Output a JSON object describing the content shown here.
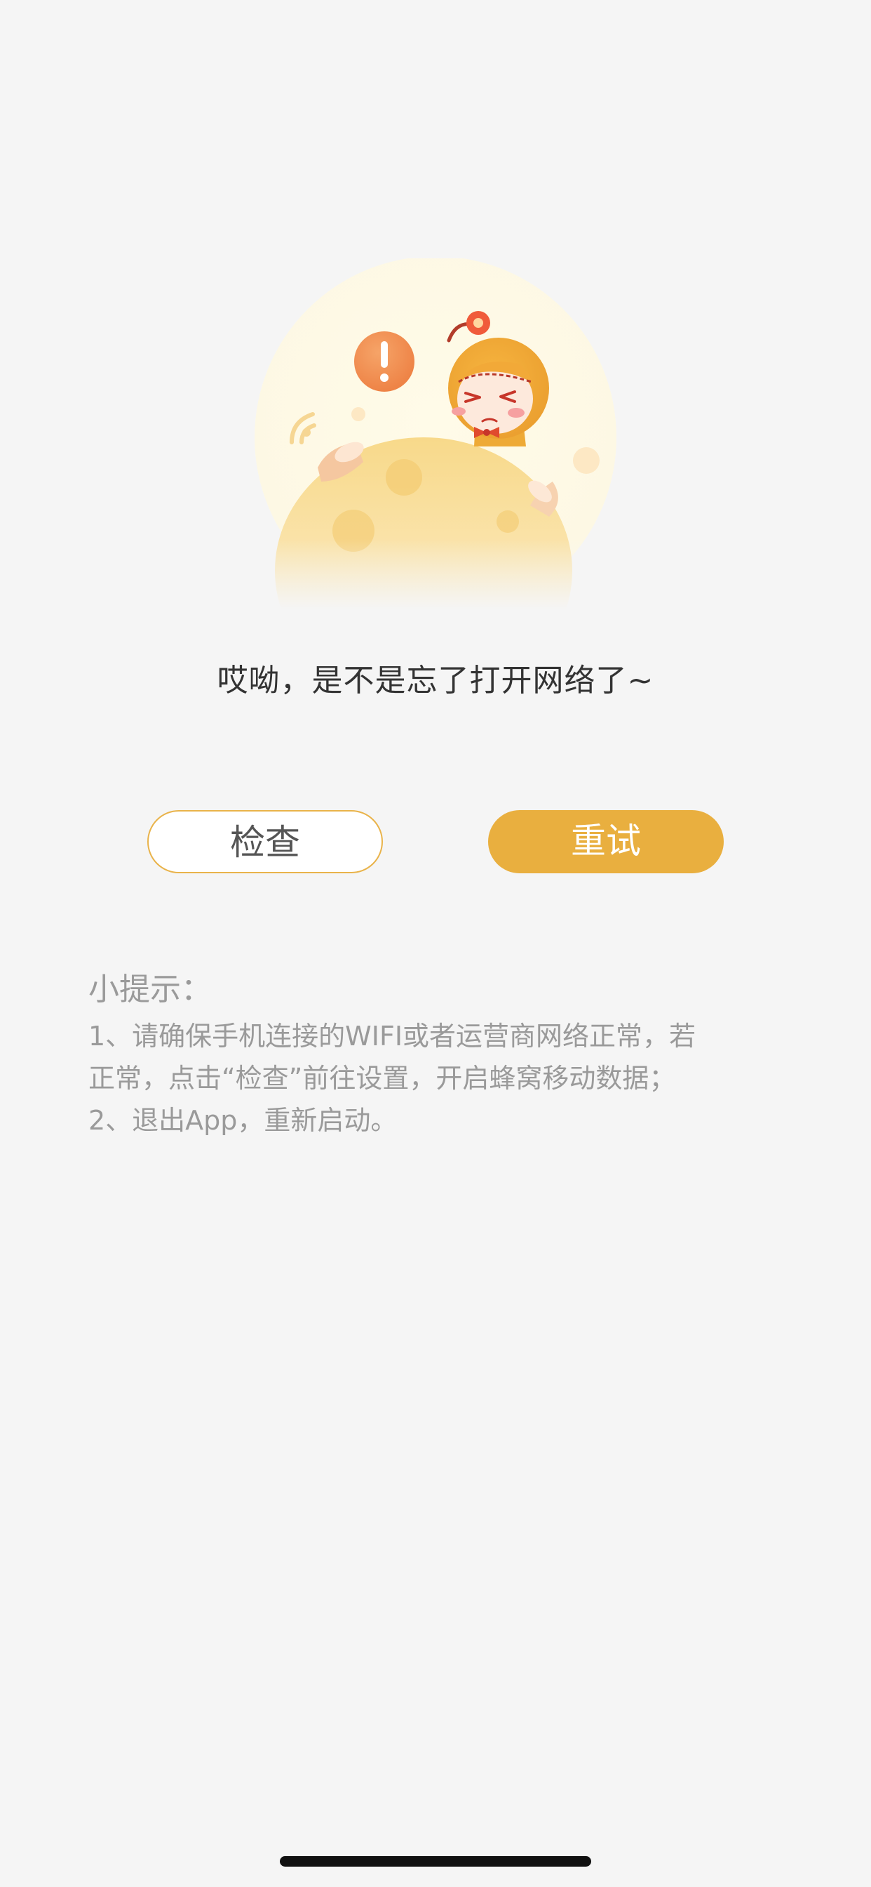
{
  "error": {
    "message": "哎呦，是不是忘了打开网络了~"
  },
  "actions": {
    "check_label": "检查",
    "retry_label": "重试"
  },
  "tips": {
    "title": "小提示：",
    "lines": [
      "1、请确保手机连接的WIFI或者运营商网络正常，若",
      "正常，点击“检查”前往设置，开启蜂窝移动数据；",
      "2、退出App，重新启动。"
    ]
  },
  "colors": {
    "accent": "#e9af3f",
    "background": "#f5f5f5",
    "tips_text": "#9a9a9a"
  },
  "icons": {
    "illustration": "no-network-moon-girl-illustration",
    "alert": "exclamation-icon",
    "signal": "wifi-signal-icon"
  }
}
